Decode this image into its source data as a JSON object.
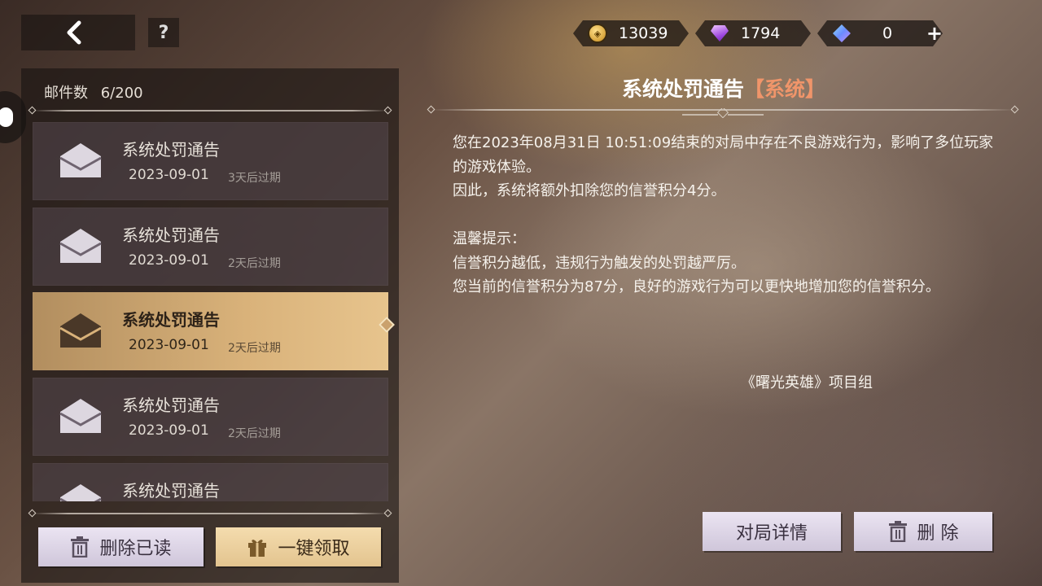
{
  "header": {
    "back_icon": "chevron-left-icon",
    "help_label": "?"
  },
  "currency": {
    "coins": "13039",
    "gems": "1794",
    "diamonds": "0",
    "add_label": "+"
  },
  "mailbox": {
    "count_label": "邮件数",
    "count_value": "6/200",
    "items": [
      {
        "subject": "系统处罚通告",
        "date": "2023-09-01",
        "expiry": "3天后过期"
      },
      {
        "subject": "系统处罚通告",
        "date": "2023-09-01",
        "expiry": "2天后过期"
      },
      {
        "subject": "系统处罚通告",
        "date": "2023-09-01",
        "expiry": "2天后过期"
      },
      {
        "subject": "系统处罚通告",
        "date": "2023-09-01",
        "expiry": "2天后过期"
      },
      {
        "subject": "系统处罚通告",
        "date": "",
        "expiry": ""
      }
    ],
    "selected_index": 2,
    "delete_read_label": "删除已读",
    "claim_all_label": "一键领取"
  },
  "detail": {
    "title": "系统处罚通告",
    "tag": "【系统】",
    "body": "您在2023年08月31日 10:51:09结束的对局中存在不良游戏行为，影响了多位玩家的游戏体验。\n因此，系统将额外扣除您的信誉积分4分。\n\n温馨提示：\n信誉积分越低，违规行为触发的处罚越严厉。\n您当前的信誉积分为87分，良好的游戏行为可以更快地增加您的信誉积分。",
    "signature": "《曙光英雄》项目组",
    "match_detail_label": "对局详情",
    "delete_label": "删 除"
  },
  "colors": {
    "selected_mail": "#d9b27a",
    "tag": "#f0956a",
    "button_light": "#ebe4f2",
    "button_gold": "#f4dcae"
  }
}
